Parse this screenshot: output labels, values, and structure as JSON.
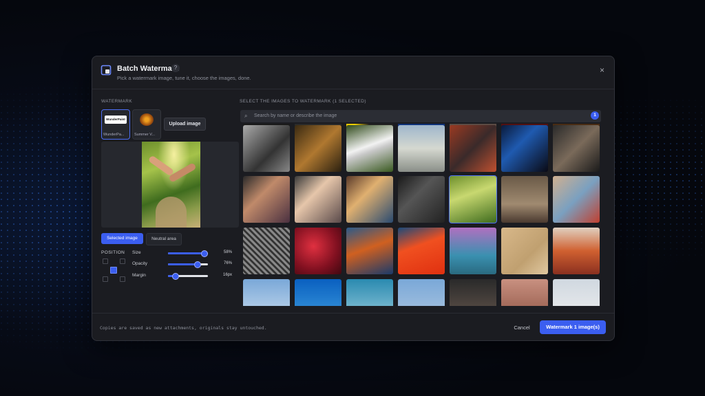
{
  "dialog": {
    "title": "Batch Watermark",
    "help_label": "?",
    "subtitle": "Pick a watermark image, tune it, choose the images, done.",
    "close_label": "×"
  },
  "watermark": {
    "section_label": "WATERMARK",
    "options": [
      {
        "caption": "WunderPa...",
        "logo_text": "WunderPaint",
        "selected": true
      },
      {
        "caption": "Summer V...",
        "logo_text": "",
        "selected": false
      }
    ],
    "upload_label": "Upload image",
    "preview_tabs": [
      {
        "label": "Selected image",
        "active": true
      },
      {
        "label": "Neutral area",
        "active": false
      }
    ],
    "position_label": "POSITION",
    "position_selected": "center",
    "sliders": [
      {
        "label": "Size",
        "value": "58%",
        "fraction": 0.9
      },
      {
        "label": "Opacity",
        "value": "76%",
        "fraction": 0.72
      },
      {
        "label": "Margin",
        "value": "16px",
        "fraction": 0.18
      }
    ]
  },
  "images": {
    "section_label": "SELECT THE IMAGES TO WATERMARK (1 SELECTED)",
    "search_placeholder": "Search by name or describe the image",
    "selected_count": "1",
    "accent": "#3b5ef0"
  },
  "footer": {
    "note": "Copies are saved as new attachments, originals stay untouched.",
    "cancel_label": "Cancel",
    "submit_label": "Watermark 1 image(s)"
  }
}
